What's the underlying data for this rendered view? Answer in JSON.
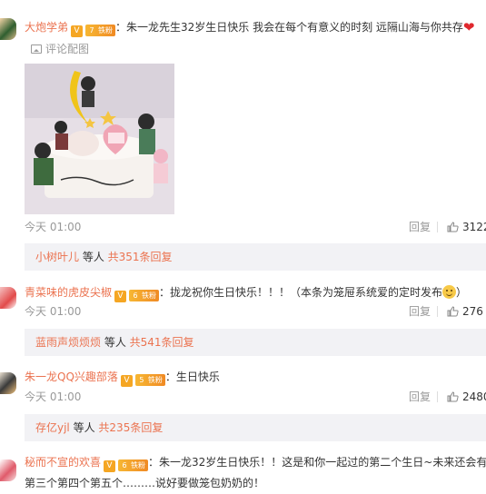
{
  "comments": [
    {
      "username": "大炮学弟",
      "vip_badge": "V",
      "fan_level": "7",
      "fan_label": "铁粉",
      "text": "：朱一龙先生32岁生日快乐 我会在每个有意义的时刻 远隔山海与你共存",
      "emoji": "heart",
      "pic_link": "评论配图",
      "time": "今天 01:00",
      "reply": "回复",
      "likes": "3122",
      "sub_user": "小树叶儿",
      "sub_mid": " 等人 ",
      "sub_count": "共351条回复"
    },
    {
      "username": "青菜味的虎皮尖椒",
      "vip_badge": "V",
      "fan_level": "6",
      "fan_label": "铁粉",
      "text": "：拢龙祝你生日快乐！！！（本条为笼屉系统爱的定时发布",
      "text_tail": "）",
      "emoji": "smile",
      "time": "今天 01:00",
      "reply": "回复",
      "likes": "276",
      "sub_user": "蓝雨声烦烦烦",
      "sub_mid": " 等人 ",
      "sub_count": "共541条回复"
    },
    {
      "username": "朱一龙QQ兴趣部落",
      "vip_badge": "V",
      "fan_level": "5",
      "fan_label": "铁粉",
      "text": "：生日快乐",
      "time": "今天 01:00",
      "reply": "回复",
      "likes": "2480",
      "sub_user": "存亿yjl",
      "sub_mid": " 等人 ",
      "sub_count": "共235条回复"
    },
    {
      "username": "秘而不宣的欢喜",
      "vip_badge": "V",
      "fan_level": "6",
      "fan_label": "铁粉",
      "text": "：朱一龙32岁生日快乐！！这是和你一起过的第二个生日~未来还会有",
      "text_line2": "第三个第四个第五个………说好要做笼包奶奶的！"
    }
  ],
  "colors": {
    "username": "#eb7350",
    "meta": "#999999",
    "subbox_bg": "#f2f2f5"
  }
}
